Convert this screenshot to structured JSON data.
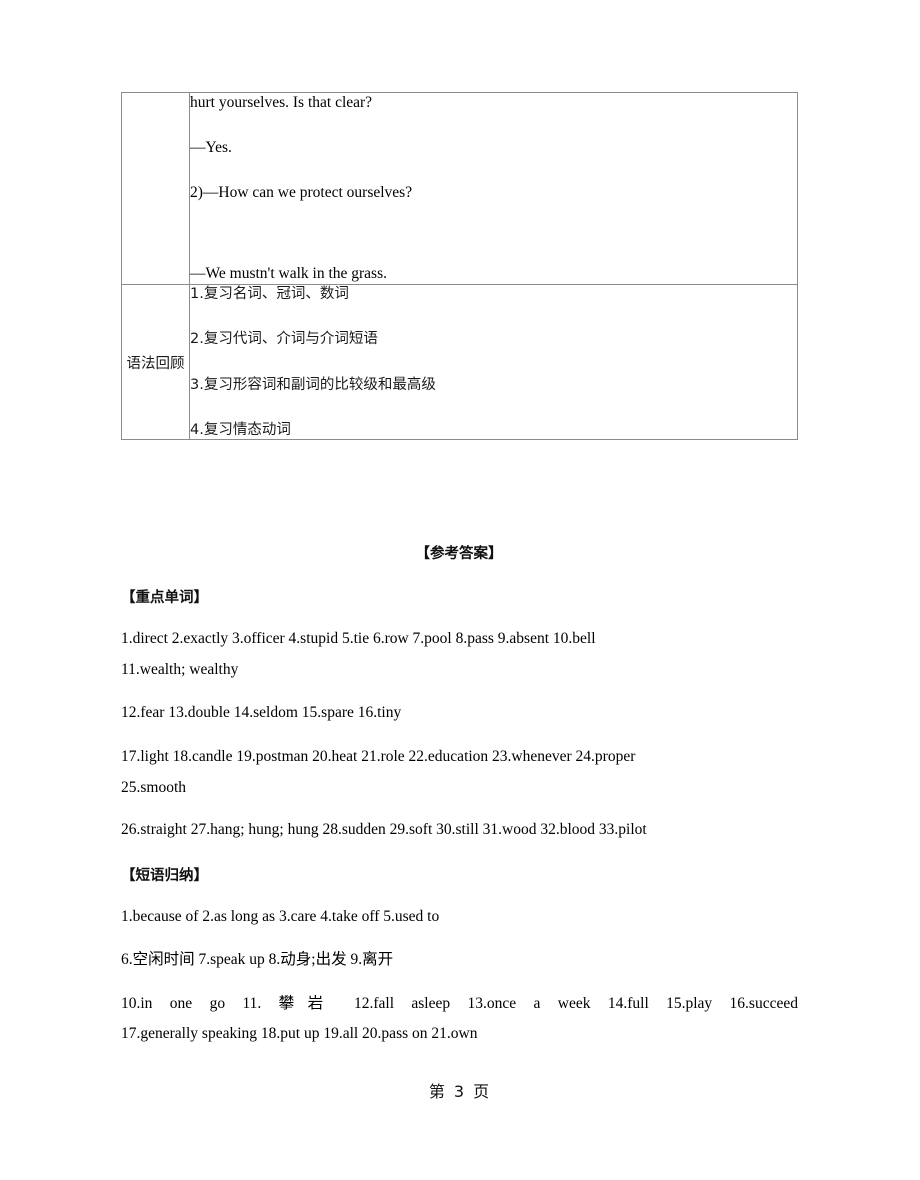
{
  "table": {
    "rows": [
      {
        "label": "",
        "lines": [
          {
            "text": "hurt yourselves. Is that clear?",
            "gap": "normal"
          },
          {
            "text": "—Yes.",
            "gap": "normal"
          },
          {
            "text": "2)—How can we protect ourselves?",
            "gap": "big"
          },
          {
            "text": "—We mustn't walk in the grass.",
            "gap": "normal"
          }
        ]
      },
      {
        "label": "语法回顾",
        "lines": [
          {
            "text": "1.复习名词、冠词、数词"
          },
          {
            "text": "2.复习代词、介词与介词短语"
          },
          {
            "text": "3.复习形容词和副词的比较级和最高级"
          },
          {
            "text": "4.复习情态动词"
          }
        ]
      }
    ]
  },
  "answers": {
    "title": "【参考答案】",
    "words_heading": "【重点单词】",
    "word_lines": [
      "1.direct   2.exactly   3.officer   4.stupid   5.tie   6.row   7.pool   8.pass   9.absent   10.bell",
      "11.wealth; wealthy",
      "12.fear   13.double   14.seldom   15.spare   16.tiny",
      "17.light   18.candle   19.postman   20.heat   21.role   22.education   23.whenever   24.proper",
      "25.smooth",
      "26.straight   27.hang; hung; hung   28.sudden   29.soft   30.still   31.wood   32.blood   33.pilot"
    ],
    "phrases_heading": "【短语归纳】",
    "phrase_lines": [
      "1.because of   2.as long as   3.care   4.take off   5.used to",
      "6.空闲时间   7.speak up   8.动身;出发   9.离开",
      "10.in one go   11. 攀岩   12.fall asleep   13.once a week   14.full   15.play   16.succeed",
      "17.generally speaking   18.put up   19.all   20.pass on   21.own"
    ]
  },
  "footer": {
    "page_label": "第 3 页"
  },
  "colors": {
    "table_border": "#8c8c8c",
    "text": "#000000",
    "background": "#ffffff"
  }
}
